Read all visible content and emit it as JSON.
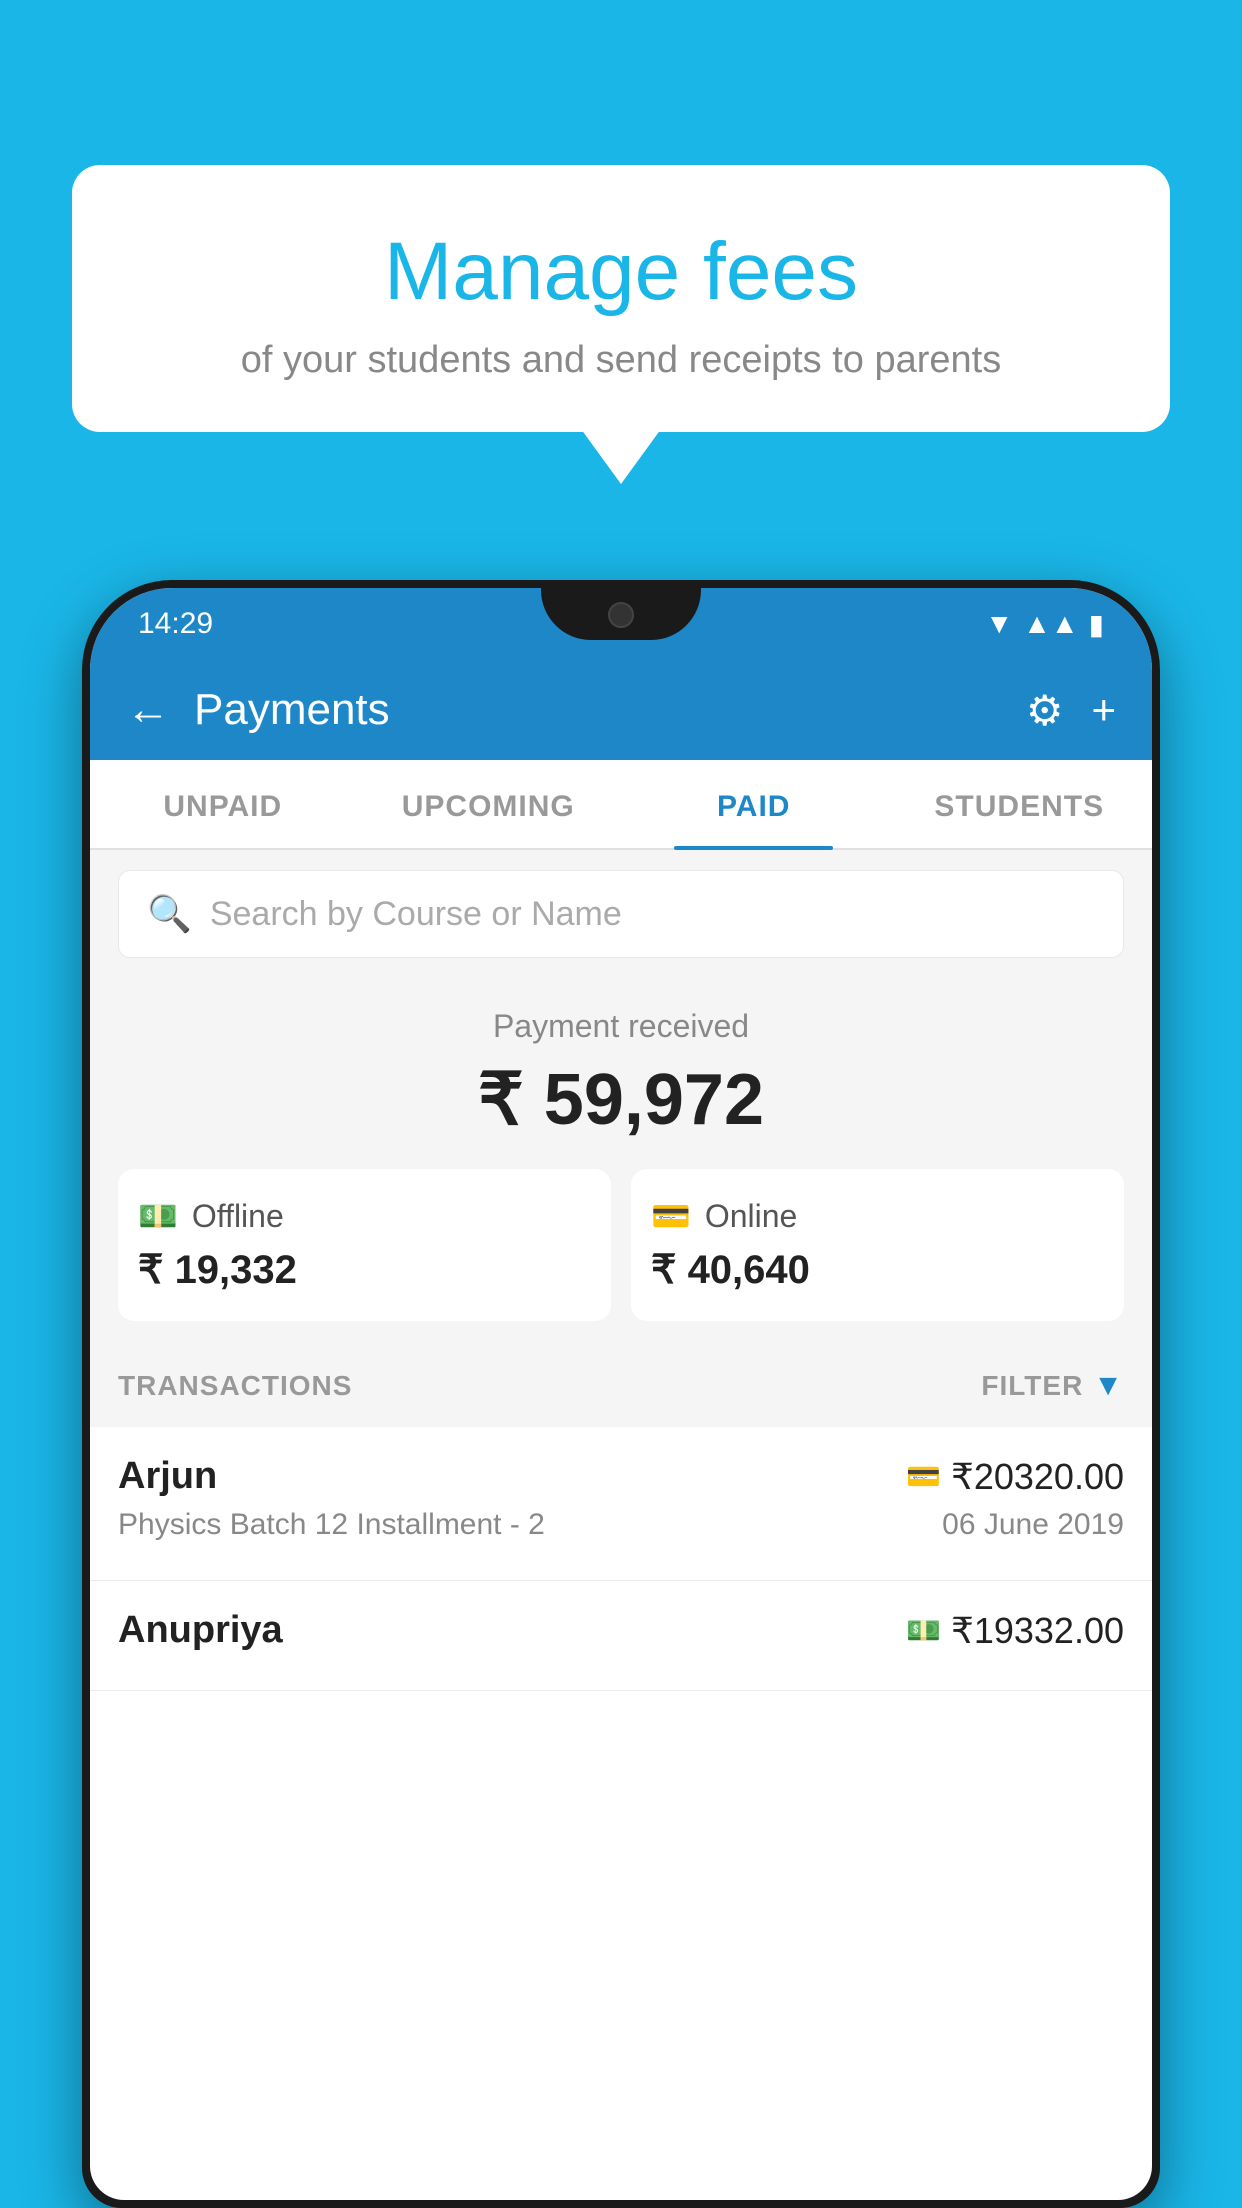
{
  "background_color": "#1ab6e8",
  "bubble": {
    "title": "Manage fees",
    "subtitle": "of your students and send receipts to parents"
  },
  "status_bar": {
    "time": "14:29",
    "wifi_icon": "▼",
    "signal_icon": "▲",
    "battery_icon": "▮"
  },
  "app_bar": {
    "back_icon": "←",
    "title": "Payments",
    "gear_icon": "⚙",
    "plus_icon": "+"
  },
  "tabs": [
    {
      "label": "UNPAID",
      "active": false
    },
    {
      "label": "UPCOMING",
      "active": false
    },
    {
      "label": "PAID",
      "active": true
    },
    {
      "label": "STUDENTS",
      "active": false
    }
  ],
  "search": {
    "placeholder": "Search by Course or Name"
  },
  "payment_summary": {
    "label": "Payment received",
    "amount": "₹ 59,972",
    "offline": {
      "label": "Offline",
      "amount": "₹ 19,332"
    },
    "online": {
      "label": "Online",
      "amount": "₹ 40,640"
    }
  },
  "transactions": {
    "header_label": "TRANSACTIONS",
    "filter_label": "FILTER",
    "items": [
      {
        "name": "Arjun",
        "amount": "₹20320.00",
        "detail": "Physics Batch 12 Installment - 2",
        "date": "06 June 2019",
        "payment_type": "card"
      },
      {
        "name": "Anupriya",
        "amount": "₹19332.00",
        "detail": "",
        "date": "",
        "payment_type": "cash"
      }
    ]
  }
}
